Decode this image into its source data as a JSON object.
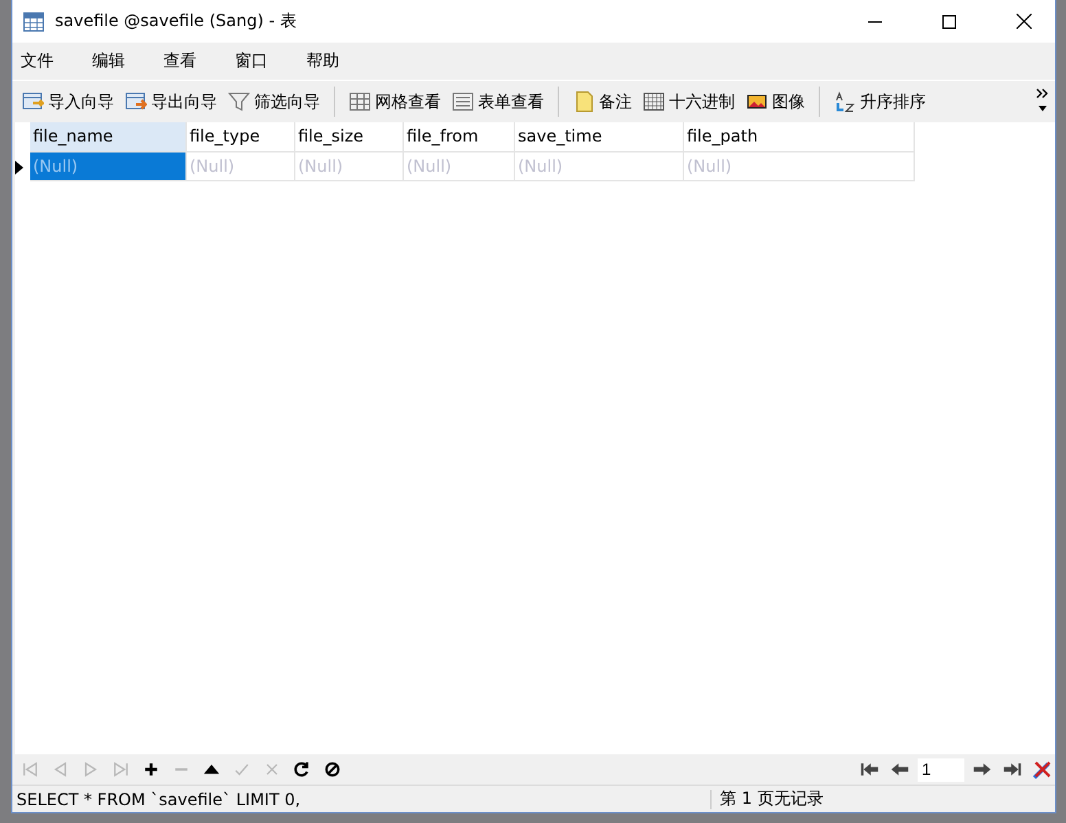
{
  "window": {
    "title": "savefile @savefile (Sang) - 表"
  },
  "menu": [
    "文件",
    "编辑",
    "查看",
    "窗口",
    "帮助"
  ],
  "toolbar": [
    {
      "kind": "import",
      "label": "导入向导"
    },
    {
      "kind": "export",
      "label": "导出向导"
    },
    {
      "kind": "filter",
      "label": "筛选向导"
    },
    {
      "kind": "sep"
    },
    {
      "kind": "grid",
      "label": "网格查看"
    },
    {
      "kind": "form",
      "label": "表单查看"
    },
    {
      "kind": "sep"
    },
    {
      "kind": "note",
      "label": "备注"
    },
    {
      "kind": "hex",
      "label": "十六进制"
    },
    {
      "kind": "image",
      "label": "图像"
    },
    {
      "kind": "sep"
    },
    {
      "kind": "sort",
      "label": "升序排序"
    }
  ],
  "table": {
    "columns": [
      {
        "label": "file_name",
        "selected": true
      },
      {
        "label": "file_type",
        "selected": false
      },
      {
        "label": "file_size",
        "selected": false
      },
      {
        "label": "file_from",
        "selected": false
      },
      {
        "label": "save_time",
        "selected": false
      },
      {
        "label": "file_path",
        "selected": false
      }
    ],
    "rows": [
      {
        "current": true,
        "cells": [
          {
            "text": "(Null)",
            "selected": true
          },
          {
            "text": "(Null)",
            "selected": false
          },
          {
            "text": "(Null)",
            "selected": false
          },
          {
            "text": "(Null)",
            "selected": false
          },
          {
            "text": "(Null)",
            "selected": false
          },
          {
            "text": "(Null)",
            "selected": false
          }
        ]
      }
    ]
  },
  "nav_buttons": [
    {
      "kind": "first",
      "disabled": true
    },
    {
      "kind": "prev",
      "disabled": true
    },
    {
      "kind": "next",
      "disabled": true
    },
    {
      "kind": "last",
      "disabled": true
    },
    {
      "kind": "add",
      "disabled": false
    },
    {
      "kind": "delete",
      "disabled": true
    },
    {
      "kind": "up",
      "disabled": false
    },
    {
      "kind": "apply",
      "disabled": true
    },
    {
      "kind": "cancel",
      "disabled": true
    },
    {
      "kind": "refresh",
      "disabled": false
    },
    {
      "kind": "stop",
      "disabled": false
    }
  ],
  "pager": {
    "page": "1"
  },
  "status_bar": {
    "query": "SELECT * FROM `savefile` LIMIT 0,",
    "page_info": "第 1 页无记录"
  }
}
